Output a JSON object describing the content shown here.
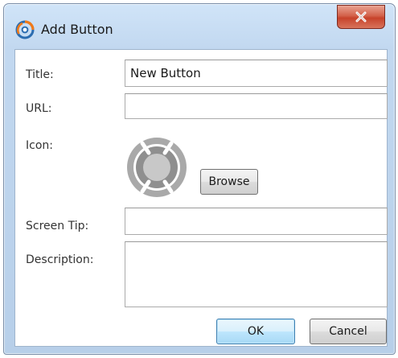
{
  "window": {
    "title": "Add Button",
    "close_glyph": "x"
  },
  "form": {
    "title_label": "Title:",
    "title_value": "New Button",
    "url_label": "URL:",
    "url_value": "",
    "icon_label": "Icon:",
    "icon_preview": "placeholder-lifebuoy-icon",
    "browse_label": "Browse",
    "screen_tip_label": "Screen Tip:",
    "screen_tip_value": "",
    "description_label": "Description:",
    "description_value": ""
  },
  "footer": {
    "ok_label": "OK",
    "cancel_label": "Cancel"
  },
  "colors": {
    "frame": "#c2d8f0",
    "close_button": "#c7432b",
    "default_button_border": "#3c7fb1",
    "app_icon_orange": "#f07a1a",
    "app_icon_blue": "#2b6cb0"
  }
}
